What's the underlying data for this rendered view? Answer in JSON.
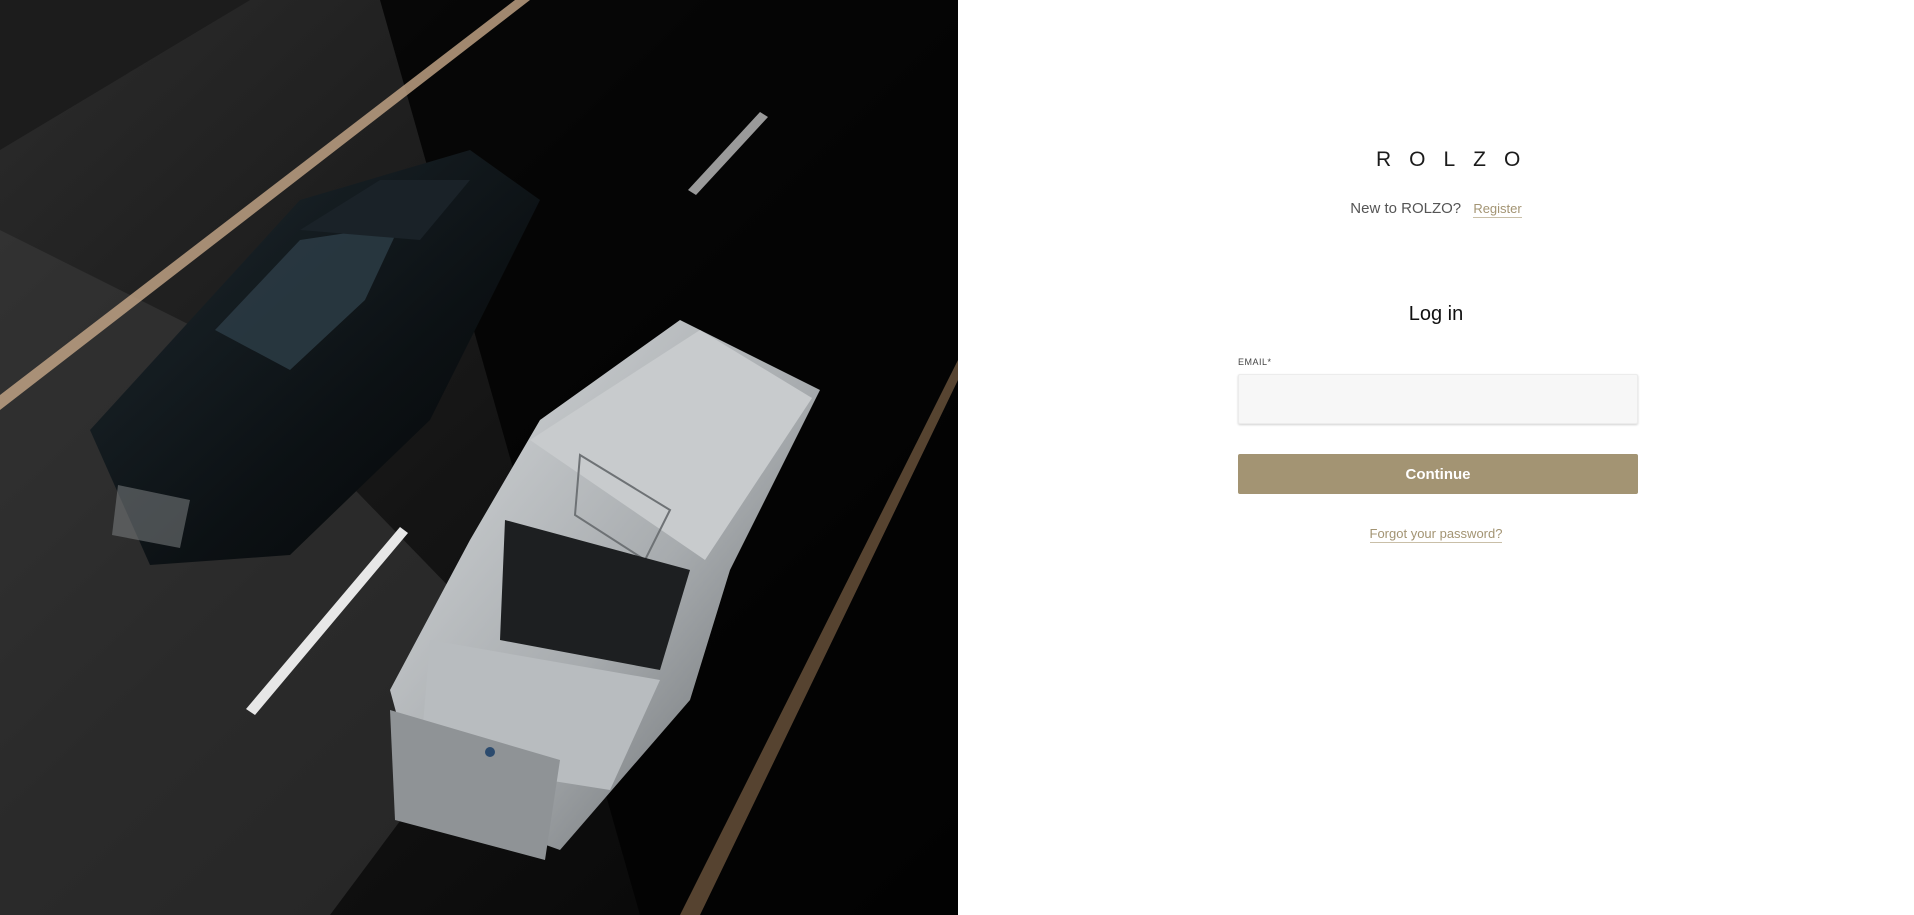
{
  "brand": {
    "logo_text": "ROLZO",
    "accent_color": "#a39473"
  },
  "hero": {
    "image": "black-luxury-sedan-and-white-suv-on-road-top-view"
  },
  "register": {
    "question": "New to ROLZO?",
    "link_label": "Register"
  },
  "login": {
    "title": "Log in",
    "email_label": "EMAIL*",
    "email_value": "",
    "continue_label": "Continue",
    "forgot_label": "Forgot your password?"
  }
}
